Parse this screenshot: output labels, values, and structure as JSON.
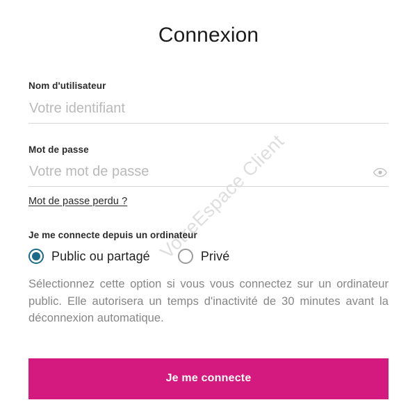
{
  "watermark": {
    "text": "VotreEspace Client",
    "color": "#dedede"
  },
  "page": {
    "title": "Connexion",
    "background": "#ffffff"
  },
  "fields": {
    "username": {
      "label": "Nom d'utilisateur",
      "placeholder": "Votre identifiant",
      "value": ""
    },
    "password": {
      "label": "Mot de passe",
      "placeholder": "Votre mot de passe",
      "value": "",
      "toggle_icon": "eye-icon"
    }
  },
  "links": {
    "forgot_password": "Mot de passe perdu ?"
  },
  "computer_type": {
    "legend": "Je me connecte depuis un ordinateur",
    "options": [
      {
        "label": "Public ou partagé",
        "selected": true
      },
      {
        "label": "Privé",
        "selected": false
      }
    ],
    "selected_color": "#1b6b88",
    "helper_text": "Sélectionnez cette option si vous vous connectez sur un ordinateur public. Elle autorisera un temps d'inactivité de 30 minutes avant la déconnexion automatique."
  },
  "submit": {
    "label": "Je me connecte",
    "color": "#d41a7f",
    "text_color": "#ffffff"
  }
}
